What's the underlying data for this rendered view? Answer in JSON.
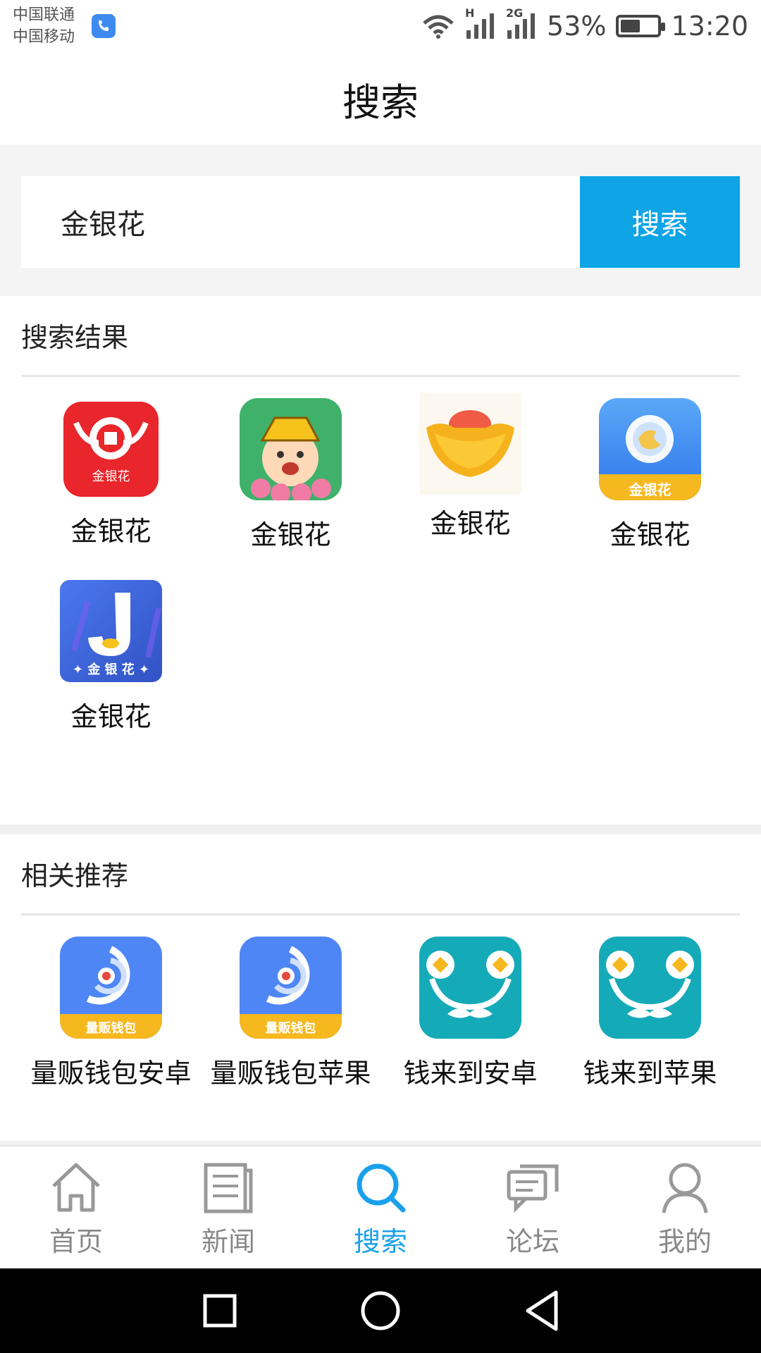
{
  "status_bar": {
    "carrier_1": "中国联通",
    "carrier_2": "中国移动",
    "network_h": "H",
    "network_2g": "2G",
    "battery": "53%",
    "battery_level": 0.53,
    "time": "13:20"
  },
  "header": {
    "title": "搜索"
  },
  "search": {
    "value": "金银花",
    "button_label": "搜索"
  },
  "results": {
    "title": "搜索结果",
    "apps": [
      {
        "name": "金银花",
        "icon": "jinyinhua-red-coin-icon",
        "color": "#e8262b",
        "icon_text": "金银花"
      },
      {
        "name": "金银花",
        "icon": "jinyinhua-cartoon-girl-icon",
        "color": "#3fb16a"
      },
      {
        "name": "金银花",
        "icon": "jinyinhua-gold-ingot-icon",
        "color": "#f6b21c"
      },
      {
        "name": "金银花",
        "icon": "jinyinhua-blue-coin-icon",
        "color": "#3d8bf2",
        "icon_text": "金银花"
      },
      {
        "name": "金银花",
        "icon": "jinyinhua-letter-j-icon",
        "color": "#3d63d6",
        "icon_text": "✦ 金 银 花 ✦"
      }
    ]
  },
  "recommend": {
    "title": "相关推荐",
    "apps": [
      {
        "name": "量贩钱包安卓",
        "icon": "liangfan-wallet-icon",
        "color": "#4f86f5",
        "icon_text": "量贩钱包"
      },
      {
        "name": "量贩钱包苹果",
        "icon": "liangfan-wallet-icon",
        "color": "#4f86f5",
        "icon_text": "量贩钱包"
      },
      {
        "name": "钱来到安卓",
        "icon": "qianlaidao-mustache-icon",
        "color": "#15aab8"
      },
      {
        "name": "钱来到苹果",
        "icon": "qianlaidao-mustache-icon",
        "color": "#15aab8"
      }
    ]
  },
  "bottom_nav": [
    {
      "label": "首页",
      "icon": "home-icon",
      "active": false
    },
    {
      "label": "新闻",
      "icon": "news-icon",
      "active": false
    },
    {
      "label": "搜索",
      "icon": "search-icon",
      "active": true
    },
    {
      "label": "论坛",
      "icon": "forum-icon",
      "active": false
    },
    {
      "label": "我的",
      "icon": "profile-icon",
      "active": false
    }
  ],
  "colors": {
    "accent": "#1aa0ea",
    "search_button": "#0ea4e6",
    "inactive": "#888888"
  }
}
